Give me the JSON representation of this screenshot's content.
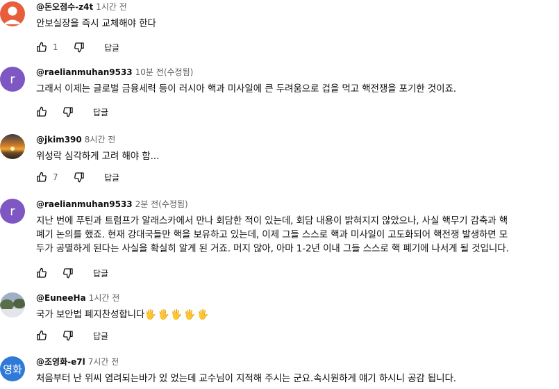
{
  "comments": [
    {
      "author": "@돈오점수-z4t",
      "time": "1시간 전",
      "text": "안보실장을 즉시 교체해야 한다",
      "likes": "1",
      "reply": "답글"
    },
    {
      "author": "@raelianmuhan9533",
      "time": "10분 전(수정됨)",
      "avatar_letter": "r",
      "text": "그래서 이제는 글로벌 금융세력 등이 러시아 핵과 미사일에 큰 두려움으로 겁을 먹고 핵전쟁을 포기한 것이죠.",
      "likes": "",
      "reply": "답글"
    },
    {
      "author": "@jkim390",
      "time": "8시간 전",
      "text": "위성락 심각하게 고려 해야 함...",
      "likes": "7",
      "reply": "답글"
    },
    {
      "author": "@raelianmuhan9533",
      "time": "2분 전(수정됨)",
      "avatar_letter": "r",
      "text_lines": [
        "지난 번에 푸틴과 트럼프가 알래스카에서 만나 회담한 적이 있는데, 회담 내용이 밝혀지지 않았으나, 사실 핵무기 감축과 핵",
        "폐기 논의를 했죠. 현재 강대국들만 핵을 보유하고 있는데, 이제 그들 스스로 핵과 미사일이 고도화되어 핵전쟁 발생하면 모",
        "두가 공멸하게 된다는 사실을 확실히 알게 된 거죠. 머지 않아, 아마 1-2년 이내 그들 스스로 핵 폐기에 나서게 될 것입니다."
      ],
      "likes": "",
      "reply": "답글"
    },
    {
      "author": "@EuneeHa",
      "time": "1시간 전",
      "text": "국가 보안법 폐지찬성합니다",
      "emojis": "🖐🖐🖐🖐🖐",
      "likes": "",
      "reply": "답글"
    },
    {
      "author": "@조영화-e7l",
      "time": "7시간 전",
      "avatar_text": "영화",
      "text": "처음부터 난 위씨 염려되는바가 있 었는데 교수님이 지적해 주시는 군요.속시원하게 얘기 하시니 공감 됩니다."
    }
  ],
  "colors": {
    "avatar_orange": "#e85d3c",
    "avatar_purple": "#7e57c2",
    "avatar_blue": "#2f7ad8",
    "meta_gray": "#606060"
  },
  "icons": [
    "thumb-up-icon",
    "thumb-down-icon"
  ]
}
